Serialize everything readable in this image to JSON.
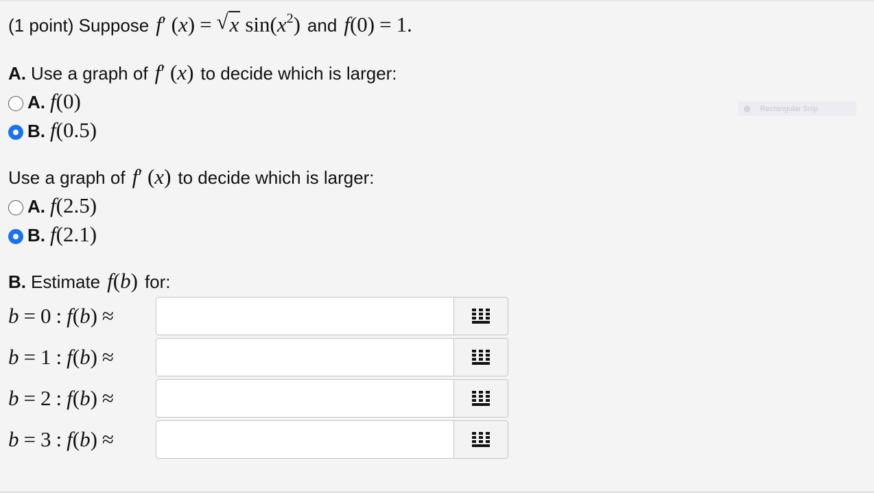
{
  "intro": {
    "lead": "(1 point) Suppose",
    "and": "and",
    "period": "."
  },
  "partA": {
    "letter": "A.",
    "prompt": "Use a graph of",
    "tail": "to decide which is larger:",
    "options": [
      {
        "letter": "A.",
        "arg": "0",
        "selected": false
      },
      {
        "letter": "B.",
        "arg": "0.5",
        "selected": true
      }
    ]
  },
  "partA2": {
    "prompt": "Use a graph of",
    "tail": "to decide which is larger:",
    "options": [
      {
        "letter": "A.",
        "arg": "2.5",
        "selected": false
      },
      {
        "letter": "B.",
        "arg": "2.1",
        "selected": true
      }
    ]
  },
  "partB": {
    "letter": "B.",
    "prompt": "Estimate",
    "tail": "for:",
    "rows": [
      {
        "b": "0",
        "value": ""
      },
      {
        "b": "1",
        "value": ""
      },
      {
        "b": "2",
        "value": ""
      },
      {
        "b": "3",
        "value": ""
      }
    ]
  },
  "overlay": {
    "snip_label": "Rectangular Snip"
  },
  "colors": {
    "accent": "#1a73e8",
    "background": "#f4f4f4"
  },
  "icons": {
    "matrix_button": "grid-icon"
  }
}
